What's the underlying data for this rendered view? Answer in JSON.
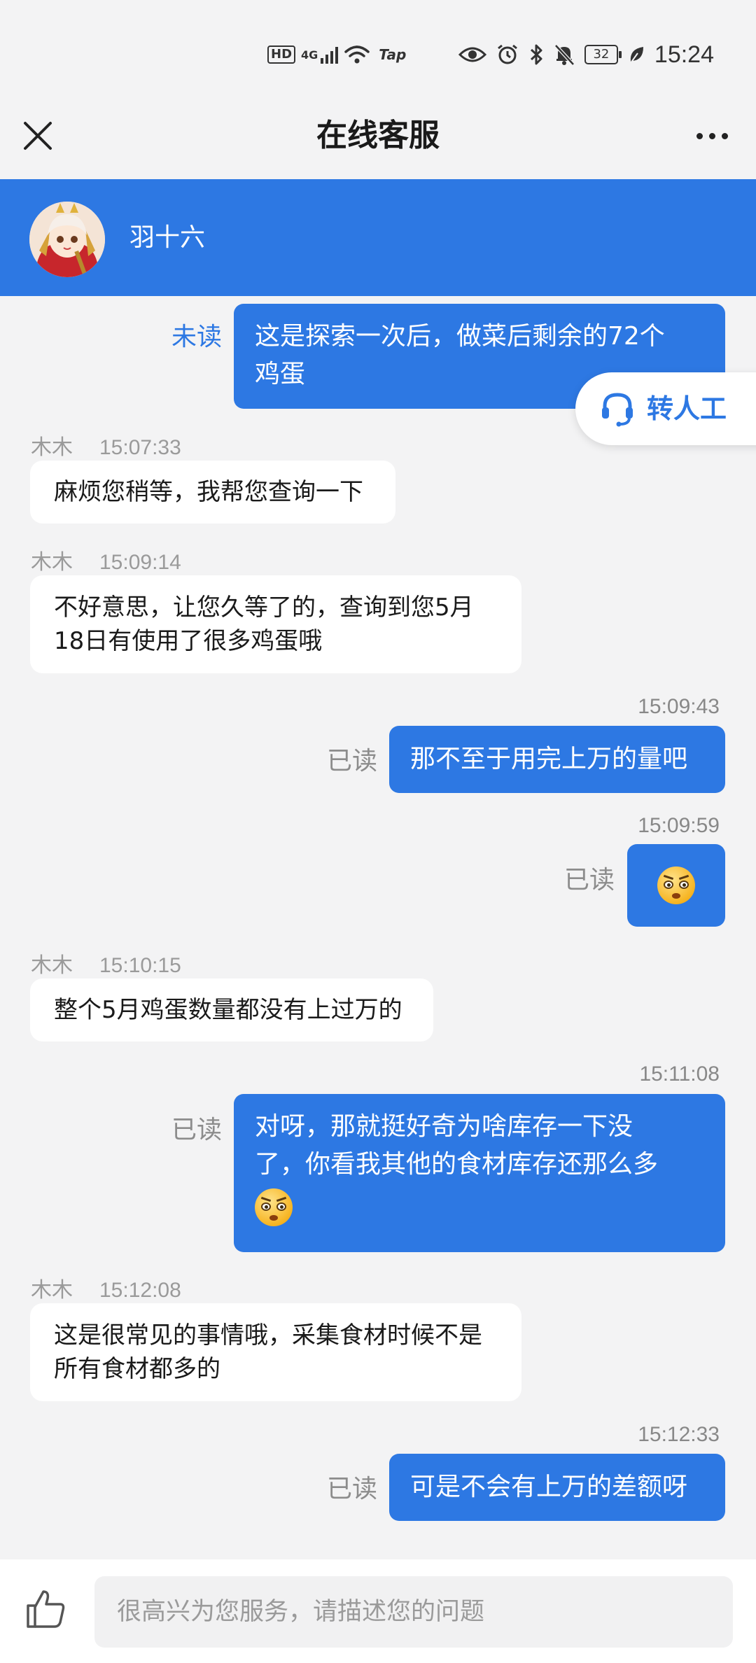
{
  "status_bar": {
    "hd": "HD",
    "network": "4G",
    "tap": "Tap",
    "battery": "32",
    "time": "15:24"
  },
  "title_bar": {
    "title": "在线客服"
  },
  "agent": {
    "name": "羽十六"
  },
  "transfer": {
    "label": "转人工"
  },
  "messages": [
    {
      "side": "right",
      "status": "未读",
      "text": [
        "这是探索一次后，做菜后剩余的72个",
        "鸡蛋"
      ]
    },
    {
      "side": "left",
      "sender": "木木",
      "time": "15:07:33",
      "text": [
        "麻烦您稍等，我帮您查询一下"
      ]
    },
    {
      "side": "left",
      "sender": "木木",
      "time": "15:09:14",
      "text": [
        "不好意思，让您久等了的，查询到您5月",
        "18日有使用了很多鸡蛋哦"
      ]
    },
    {
      "side": "right",
      "time": "15:09:43",
      "status": "已读",
      "text": [
        "那不至于用完上万的量吧"
      ]
    },
    {
      "side": "right",
      "time": "15:09:59",
      "status": "已读",
      "emoji": "rolling-eyes-emoji"
    },
    {
      "side": "left",
      "sender": "木木",
      "time": "15:10:15",
      "text": [
        "整个5月鸡蛋数量都没有上过万的"
      ]
    },
    {
      "side": "right",
      "time": "15:11:08",
      "status": "已读",
      "text": [
        "对呀，那就挺好奇为啥库存一下没",
        "了，你看我其他的食材库存还那么多"
      ],
      "emoji": "rolling-eyes-emoji"
    },
    {
      "side": "left",
      "sender": "木木",
      "time": "15:12:08",
      "text": [
        "这是很常见的事情哦，采集食材时候不是",
        "所有食材都多的"
      ]
    },
    {
      "side": "right",
      "time": "15:12:33",
      "status": "已读",
      "text": [
        "可是不会有上万的差额呀"
      ]
    }
  ],
  "input": {
    "placeholder": "很高兴为您服务，请描述您的问题"
  },
  "colors": {
    "accent": "#2d78e3",
    "background": "#f3f3f4"
  }
}
